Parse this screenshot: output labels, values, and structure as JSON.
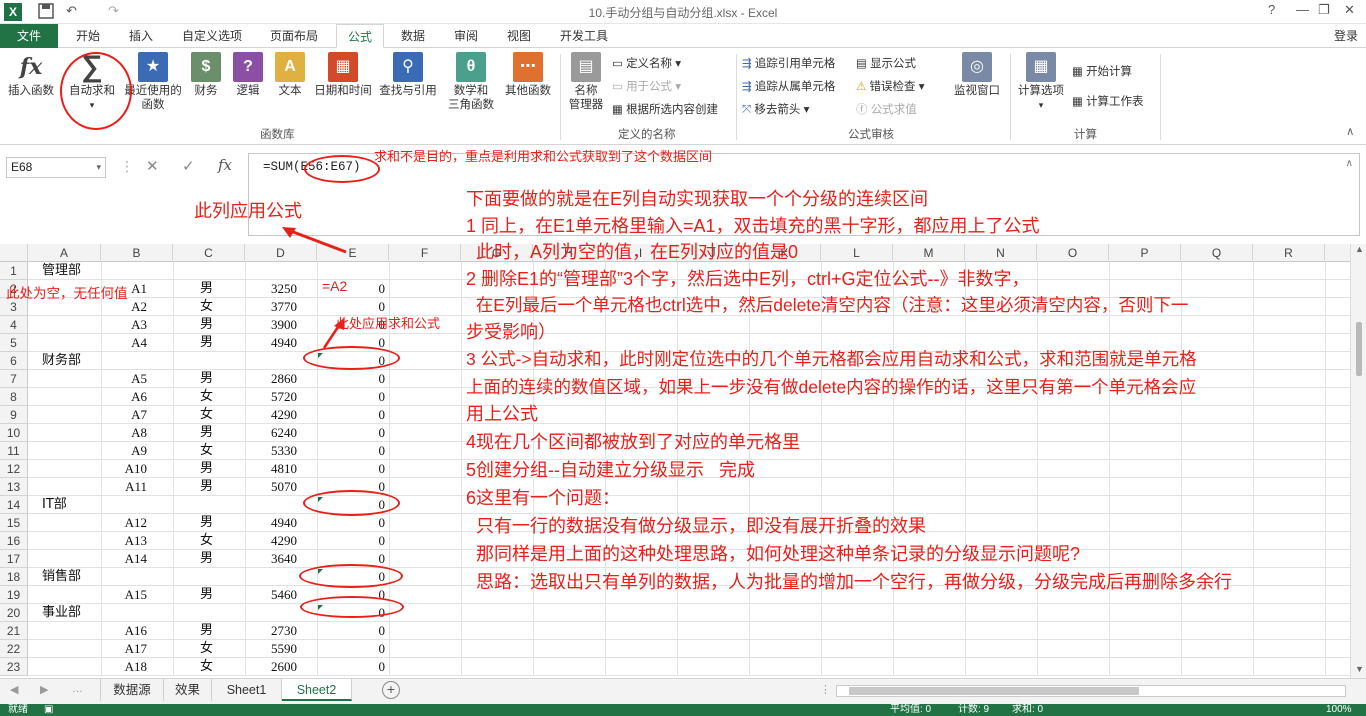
{
  "title_bar": {
    "title": "10.手动分组与自动分组.xlsx - Excel",
    "app_icon": "X",
    "undo_icon": "↶",
    "redo_icon": "↷",
    "save_icon": "save-icon",
    "help": "?",
    "minimize": "—",
    "restore": "❐",
    "close": "✕"
  },
  "tabs": [
    "文件",
    "开始",
    "插入",
    "自定义选项",
    "页面布局",
    "公式",
    "数据",
    "审阅",
    "视图",
    "开发工具"
  ],
  "active_tab": "公式",
  "login": "登录",
  "ribbon": {
    "insert_func": "插入函数",
    "autosum": "自动求和",
    "recent": [
      "最近使用的",
      "函数"
    ],
    "finance": "财务",
    "logic": "逻辑",
    "text": "文本",
    "datetime": "日期和时间",
    "lookup": "查找与引用",
    "math": [
      "数学和",
      "三角函数"
    ],
    "other": "其他函数",
    "group_funclib": "函数库",
    "name_mgr": [
      "名称",
      "管理器"
    ],
    "define_name": "定义名称",
    "use_in_formula": "用于公式",
    "create_from_sel": "根据所选内容创建",
    "group_names": "定义的名称",
    "trace_prec": "追踪引用单元格",
    "trace_dep": "追踪从属单元格",
    "remove_arrows": "移去箭头",
    "show_formulas": "显示公式",
    "error_check": "错误检查",
    "eval_formula": "公式求值",
    "watch": "监视窗口",
    "group_audit": "公式审核",
    "calc_options": "计算选项",
    "calc_now": "开始计算",
    "calc_sheet": "计算工作表",
    "group_calc": "计算",
    "fx_symbol": "fx",
    "sigma_symbol": "∑"
  },
  "formula_bar": {
    "name_box": "E68",
    "formula": "=SUM(E56:E67)",
    "cancel": "✕",
    "enter": "✓",
    "fx": "fx"
  },
  "columns": [
    "A",
    "B",
    "C",
    "D",
    "E",
    "F",
    "G",
    "H",
    "I",
    "J",
    "K",
    "L",
    "M",
    "N",
    "O",
    "P",
    "Q",
    "R"
  ],
  "rows": [
    {
      "n": "1",
      "a": "管理部",
      "b": "",
      "c": "",
      "d": "",
      "e": ""
    },
    {
      "n": "2",
      "a": "",
      "b": "A1",
      "c": "男",
      "d": "3250",
      "e": "0"
    },
    {
      "n": "3",
      "a": "",
      "b": "A2",
      "c": "女",
      "d": "3770",
      "e": "0"
    },
    {
      "n": "4",
      "a": "",
      "b": "A3",
      "c": "男",
      "d": "3900",
      "e": "0"
    },
    {
      "n": "5",
      "a": "",
      "b": "A4",
      "c": "男",
      "d": "4940",
      "e": "0"
    },
    {
      "n": "6",
      "a": "财务部",
      "b": "",
      "c": "",
      "d": "",
      "e": "0"
    },
    {
      "n": "7",
      "a": "",
      "b": "A5",
      "c": "男",
      "d": "2860",
      "e": "0"
    },
    {
      "n": "8",
      "a": "",
      "b": "A6",
      "c": "女",
      "d": "5720",
      "e": "0"
    },
    {
      "n": "9",
      "a": "",
      "b": "A7",
      "c": "女",
      "d": "4290",
      "e": "0"
    },
    {
      "n": "10",
      "a": "",
      "b": "A8",
      "c": "男",
      "d": "6240",
      "e": "0"
    },
    {
      "n": "11",
      "a": "",
      "b": "A9",
      "c": "女",
      "d": "5330",
      "e": "0"
    },
    {
      "n": "12",
      "a": "",
      "b": "A10",
      "c": "男",
      "d": "4810",
      "e": "0"
    },
    {
      "n": "13",
      "a": "",
      "b": "A11",
      "c": "男",
      "d": "5070",
      "e": "0"
    },
    {
      "n": "14",
      "a": "IT部",
      "b": "",
      "c": "",
      "d": "",
      "e": "0"
    },
    {
      "n": "15",
      "a": "",
      "b": "A12",
      "c": "男",
      "d": "4940",
      "e": "0"
    },
    {
      "n": "16",
      "a": "",
      "b": "A13",
      "c": "女",
      "d": "4290",
      "e": "0"
    },
    {
      "n": "17",
      "a": "",
      "b": "A14",
      "c": "男",
      "d": "3640",
      "e": "0"
    },
    {
      "n": "18",
      "a": "销售部",
      "b": "",
      "c": "",
      "d": "",
      "e": "0"
    },
    {
      "n": "19",
      "a": "",
      "b": "A15",
      "c": "男",
      "d": "5460",
      "e": "0"
    },
    {
      "n": "20",
      "a": "事业部",
      "b": "",
      "c": "",
      "d": "",
      "e": "0"
    },
    {
      "n": "21",
      "a": "",
      "b": "A16",
      "c": "男",
      "d": "2730",
      "e": "0"
    },
    {
      "n": "22",
      "a": "",
      "b": "A17",
      "c": "女",
      "d": "5590",
      "e": "0"
    },
    {
      "n": "23",
      "a": "",
      "b": "A18",
      "c": "女",
      "d": "2600",
      "e": "0"
    }
  ],
  "sheets": [
    "数据源",
    "效果",
    "Sheet1",
    "Sheet2"
  ],
  "active_sheet": "Sheet2",
  "status": {
    "ready": "就绪",
    "avg": "平均值: 0",
    "count": "计数: 9",
    "sum": "求和: 0",
    "zoom": "100%"
  },
  "annotations": {
    "formula_note": "求和不是目的，重点是利用求和公式获取到了这个数据区间",
    "col_note": "此列应用公式",
    "empty_note": "此处为空，无任何值",
    "e2_note": "=A2",
    "sum_note": "此处应用求和公式",
    "steps": [
      "下面要做的就是在E列自动实现获取一个个分级的连续区间",
      "1 同上，在E1单元格里输入=A1，双击填充的黑十字形，都应用上了公式",
      "  此时，A列为空的值，在E列对应的值是0",
      "2 删除E1的“管理部”3个字，然后选中E列，ctrl+G定位公式--》非数字，",
      "  在E列最后一个单元格也ctrl选中，然后delete清空内容（注意：这里必须清空内容，否则下一",
      "步受影响）",
      "3 公式->自动求和，此时刚定位选中的几个单元格都会应用自动求和公式，求和范围就是单元格",
      "上面的连续的数值区域，如果上一步没有做delete内容的操作的话，这里只有第一个单元格会应",
      "用上公式",
      "4现在几个区间都被放到了对应的单元格里",
      "5创建分组--自动建立分级显示   完成",
      "6这里有一个问题：",
      "  只有一行的数据没有做分级显示，即没有展开折叠的效果",
      "  那同样是用上面的这种处理思路，如何处理这种单条记录的分级显示问题呢?",
      "  思路：选取出只有单列的数据，人为批量的增加一个空行，再做分级，分级完成后再删除多余行"
    ]
  },
  "colors": {
    "excel_green": "#217346",
    "annotation_red": "#e8201a"
  }
}
